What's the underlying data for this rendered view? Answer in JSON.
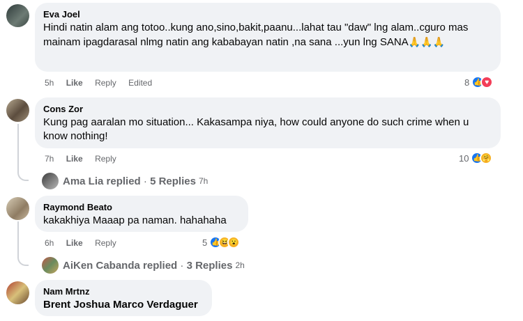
{
  "comments": [
    {
      "author": "Eva Joel",
      "text": "Hindi natin alam ang totoo..kung ano,sino,bakit,paanu...lahat tau \"daw\" lng alam..cguro mas mainam ipagdarasal nlmg natin ang kababayan natin ,na sana ...yun lng SANA",
      "time": "5h",
      "like": "Like",
      "reply": "Reply",
      "edited": "Edited",
      "reaction_count": "8",
      "reactions": [
        "like",
        "love"
      ]
    },
    {
      "author": "Cons Zor",
      "text": "Kung pag aaralan mo situation... Kakasampa niya, how could anyone do such crime when u know nothing!",
      "time": "7h",
      "like": "Like",
      "reply": "Reply",
      "reaction_count": "10",
      "reactions": [
        "like",
        "care"
      ],
      "replies": {
        "name": "Ama Lia",
        "label": "replied",
        "sep": "·",
        "count": "5 Replies",
        "time": "7h"
      }
    },
    {
      "author": "Raymond Beato",
      "text": "kakakhiya Maaap pa naman. hahahaha",
      "time": "6h",
      "like": "Like",
      "reply": "Reply",
      "reaction_count": "5",
      "reactions": [
        "like",
        "haha",
        "wow"
      ],
      "replies": {
        "name": "AiKen Cabanda",
        "label": "replied",
        "sep": "·",
        "count": "3 Replies",
        "time": "2h"
      }
    },
    {
      "author": "Nam Mrtnz",
      "text": "Brent Joshua Marco Verdaguer"
    }
  ],
  "colors": {
    "like": "#1877f2",
    "love": "#f33e58",
    "emoji": "#f7b125",
    "bubble": "#f0f2f5"
  }
}
